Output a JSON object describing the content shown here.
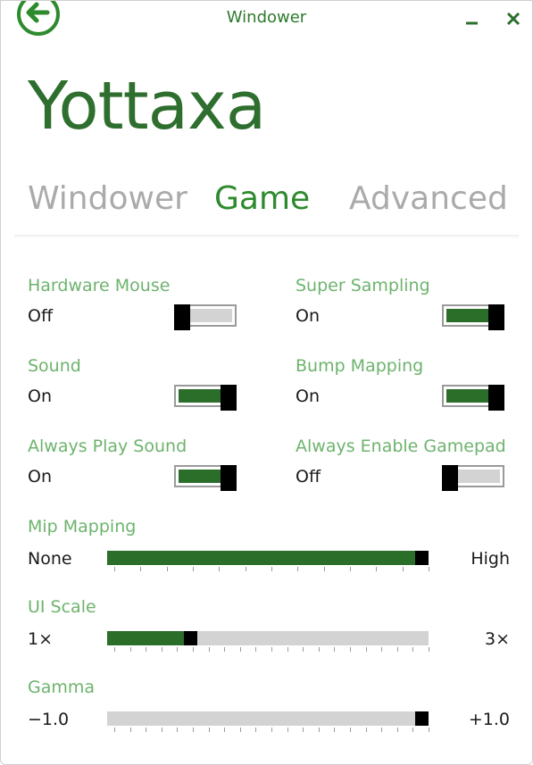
{
  "window": {
    "title": "Windower"
  },
  "app": {
    "title": "Yottaxa"
  },
  "tabs": [
    {
      "label": "Windower",
      "active": false
    },
    {
      "label": "Game",
      "active": true
    },
    {
      "label": "Advanced",
      "active": false
    }
  ],
  "toggles": {
    "hardware_mouse": {
      "label": "Hardware Mouse",
      "value": "Off",
      "on": false
    },
    "super_sampling": {
      "label": "Super Sampling",
      "value": "On",
      "on": true
    },
    "sound": {
      "label": "Sound",
      "value": "On",
      "on": true
    },
    "bump_mapping": {
      "label": "Bump Mapping",
      "value": "On",
      "on": true
    },
    "always_play_sound": {
      "label": "Always Play Sound",
      "value": "On",
      "on": true
    },
    "always_enable_gamepad": {
      "label": "Always Enable Gamepad",
      "value": "Off",
      "on": false
    }
  },
  "sliders": {
    "mip_mapping": {
      "label": "Mip Mapping",
      "min_label": "None",
      "max_label": "High",
      "fraction": 1.0,
      "ticks": 13
    },
    "ui_scale": {
      "label": "UI Scale",
      "min_label": "1×",
      "max_label": "3×",
      "fraction": 0.25,
      "ticks": 21
    },
    "gamma": {
      "label": "Gamma",
      "min_label": "−1.0",
      "max_label": "+1.0",
      "fraction": 1.0,
      "ticks": 21
    }
  },
  "colors": {
    "accent": "#2d8a2d",
    "label_green": "#6db36d",
    "track_on": "#2a6e2a",
    "track_off": "#d3d3d3"
  },
  "icons": {
    "back": "back-arrow-circle-icon",
    "minimize": "minimize-icon",
    "close": "close-icon"
  }
}
